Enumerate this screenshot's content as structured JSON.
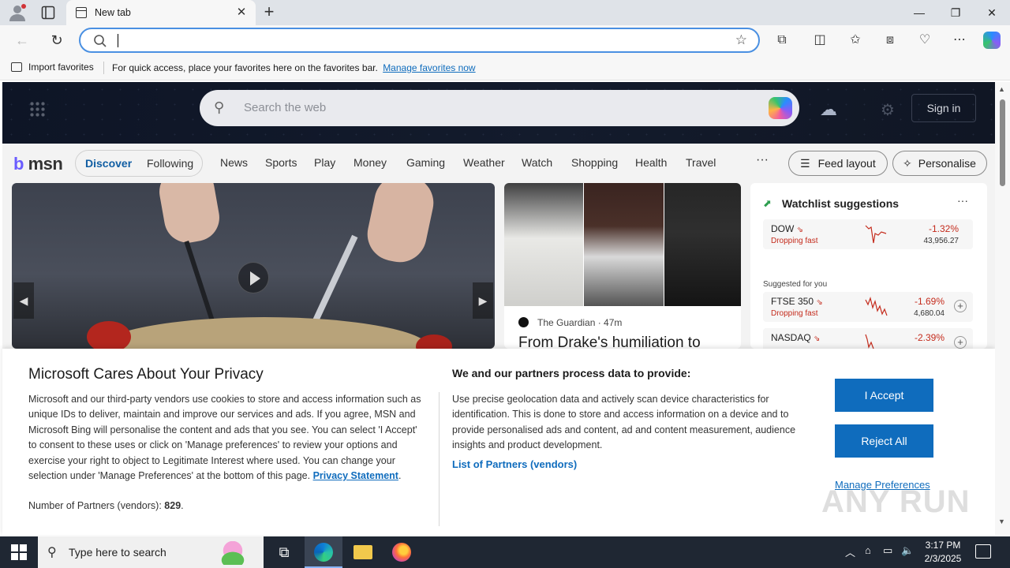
{
  "browser": {
    "tab_title": "New tab",
    "tab_close": "✕",
    "new_tab": "+",
    "address_value": "",
    "window_controls": {
      "minimize": "—",
      "restore": "❐",
      "close": "✕"
    }
  },
  "favorites_bar": {
    "import_label": "Import favorites",
    "message": "For quick access, place your favorites here on the favorites bar.",
    "manage_link": "Manage favorites now"
  },
  "msn_header": {
    "search_placeholder": "Search the web",
    "sign_in": "Sign in"
  },
  "msn_nav": {
    "logo_b": "b",
    "logo_text": "msn",
    "pill_items": [
      "Discover",
      "Following"
    ],
    "items": [
      "News",
      "Sports",
      "Play",
      "Money",
      "Gaming",
      "Weather",
      "Watch",
      "Shopping",
      "Health",
      "Travel"
    ],
    "more": "···",
    "feed_layout": "Feed layout",
    "personalise": "Personalise"
  },
  "news_card": {
    "source": "The Guardian · 47m",
    "headline": "From Drake's humiliation to"
  },
  "watchlist": {
    "title": "Watchlist suggestions",
    "more": "···",
    "suggested_label": "Suggested for you",
    "stocks": [
      {
        "name": "DOW",
        "status": "Dropping fast",
        "change": "-1.32%",
        "value": "43,956.27"
      },
      {
        "name": "FTSE 350",
        "status": "Dropping fast",
        "change": "-1.69%",
        "value": "4,680.04"
      },
      {
        "name": "NASDAQ",
        "status": "",
        "change": "-2.39%",
        "value": ""
      }
    ]
  },
  "privacy": {
    "title": "Microsoft Cares About Your Privacy",
    "body": "Microsoft and our third-party vendors use cookies to store and access information such as unique IDs to deliver, maintain and improve our services and ads. If you agree, MSN and Microsoft Bing will personalise the content and ads that you see. You can select 'I Accept' to consent to these uses or click on 'Manage preferences' to review your options and exercise your right to object to Legitimate Interest where used.  You can change your selection under 'Manage Preferences' at the bottom of this page.",
    "privacy_link": "Privacy Statement",
    "partners_label": "Number of Partners (vendors):",
    "partners_count": "829",
    "subtitle": "We and our partners process data to provide:",
    "body2": "Use precise geolocation data and actively scan device characteristics for identification. This is done to store and access information on a device and to provide personalised ads and content, ad and content measurement, audience insights and product development.",
    "partners_link": "List of Partners (vendors)",
    "accept": "I Accept",
    "reject": "Reject All",
    "manage": "Manage Preferences"
  },
  "watermark": "ANY RUN",
  "taskbar": {
    "search_placeholder": "Type here to search",
    "time": "3:17 PM",
    "date": "2/3/2025"
  },
  "colors": {
    "accent": "#0f6cbd",
    "negative": "#c42b1c",
    "taskbar": "#1f2733"
  }
}
